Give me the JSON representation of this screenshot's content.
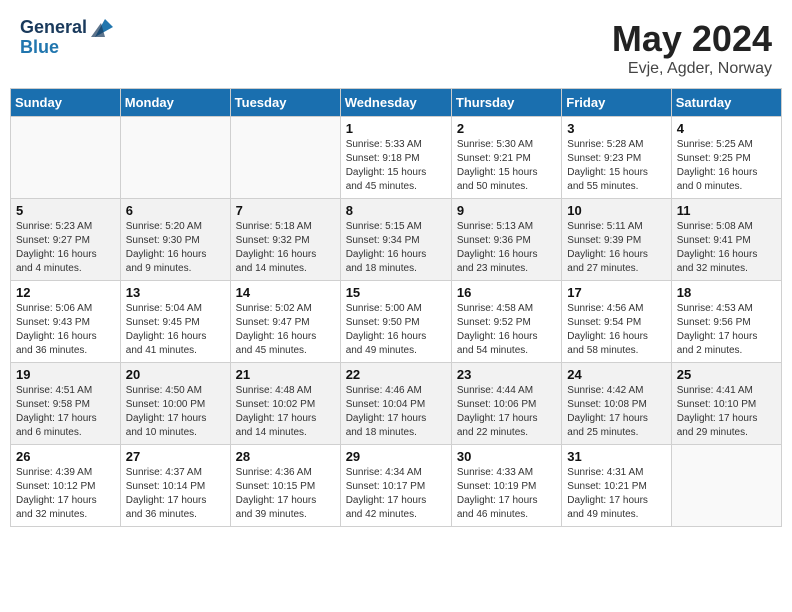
{
  "header": {
    "logo_general": "General",
    "logo_blue": "Blue",
    "month": "May 2024",
    "location": "Evje, Agder, Norway"
  },
  "weekdays": [
    "Sunday",
    "Monday",
    "Tuesday",
    "Wednesday",
    "Thursday",
    "Friday",
    "Saturday"
  ],
  "weeks": [
    [
      {
        "day": "",
        "info": ""
      },
      {
        "day": "",
        "info": ""
      },
      {
        "day": "",
        "info": ""
      },
      {
        "day": "1",
        "info": "Sunrise: 5:33 AM\nSunset: 9:18 PM\nDaylight: 15 hours\nand 45 minutes."
      },
      {
        "day": "2",
        "info": "Sunrise: 5:30 AM\nSunset: 9:21 PM\nDaylight: 15 hours\nand 50 minutes."
      },
      {
        "day": "3",
        "info": "Sunrise: 5:28 AM\nSunset: 9:23 PM\nDaylight: 15 hours\nand 55 minutes."
      },
      {
        "day": "4",
        "info": "Sunrise: 5:25 AM\nSunset: 9:25 PM\nDaylight: 16 hours\nand 0 minutes."
      }
    ],
    [
      {
        "day": "5",
        "info": "Sunrise: 5:23 AM\nSunset: 9:27 PM\nDaylight: 16 hours\nand 4 minutes."
      },
      {
        "day": "6",
        "info": "Sunrise: 5:20 AM\nSunset: 9:30 PM\nDaylight: 16 hours\nand 9 minutes."
      },
      {
        "day": "7",
        "info": "Sunrise: 5:18 AM\nSunset: 9:32 PM\nDaylight: 16 hours\nand 14 minutes."
      },
      {
        "day": "8",
        "info": "Sunrise: 5:15 AM\nSunset: 9:34 PM\nDaylight: 16 hours\nand 18 minutes."
      },
      {
        "day": "9",
        "info": "Sunrise: 5:13 AM\nSunset: 9:36 PM\nDaylight: 16 hours\nand 23 minutes."
      },
      {
        "day": "10",
        "info": "Sunrise: 5:11 AM\nSunset: 9:39 PM\nDaylight: 16 hours\nand 27 minutes."
      },
      {
        "day": "11",
        "info": "Sunrise: 5:08 AM\nSunset: 9:41 PM\nDaylight: 16 hours\nand 32 minutes."
      }
    ],
    [
      {
        "day": "12",
        "info": "Sunrise: 5:06 AM\nSunset: 9:43 PM\nDaylight: 16 hours\nand 36 minutes."
      },
      {
        "day": "13",
        "info": "Sunrise: 5:04 AM\nSunset: 9:45 PM\nDaylight: 16 hours\nand 41 minutes."
      },
      {
        "day": "14",
        "info": "Sunrise: 5:02 AM\nSunset: 9:47 PM\nDaylight: 16 hours\nand 45 minutes."
      },
      {
        "day": "15",
        "info": "Sunrise: 5:00 AM\nSunset: 9:50 PM\nDaylight: 16 hours\nand 49 minutes."
      },
      {
        "day": "16",
        "info": "Sunrise: 4:58 AM\nSunset: 9:52 PM\nDaylight: 16 hours\nand 54 minutes."
      },
      {
        "day": "17",
        "info": "Sunrise: 4:56 AM\nSunset: 9:54 PM\nDaylight: 16 hours\nand 58 minutes."
      },
      {
        "day": "18",
        "info": "Sunrise: 4:53 AM\nSunset: 9:56 PM\nDaylight: 17 hours\nand 2 minutes."
      }
    ],
    [
      {
        "day": "19",
        "info": "Sunrise: 4:51 AM\nSunset: 9:58 PM\nDaylight: 17 hours\nand 6 minutes."
      },
      {
        "day": "20",
        "info": "Sunrise: 4:50 AM\nSunset: 10:00 PM\nDaylight: 17 hours\nand 10 minutes."
      },
      {
        "day": "21",
        "info": "Sunrise: 4:48 AM\nSunset: 10:02 PM\nDaylight: 17 hours\nand 14 minutes."
      },
      {
        "day": "22",
        "info": "Sunrise: 4:46 AM\nSunset: 10:04 PM\nDaylight: 17 hours\nand 18 minutes."
      },
      {
        "day": "23",
        "info": "Sunrise: 4:44 AM\nSunset: 10:06 PM\nDaylight: 17 hours\nand 22 minutes."
      },
      {
        "day": "24",
        "info": "Sunrise: 4:42 AM\nSunset: 10:08 PM\nDaylight: 17 hours\nand 25 minutes."
      },
      {
        "day": "25",
        "info": "Sunrise: 4:41 AM\nSunset: 10:10 PM\nDaylight: 17 hours\nand 29 minutes."
      }
    ],
    [
      {
        "day": "26",
        "info": "Sunrise: 4:39 AM\nSunset: 10:12 PM\nDaylight: 17 hours\nand 32 minutes."
      },
      {
        "day": "27",
        "info": "Sunrise: 4:37 AM\nSunset: 10:14 PM\nDaylight: 17 hours\nand 36 minutes."
      },
      {
        "day": "28",
        "info": "Sunrise: 4:36 AM\nSunset: 10:15 PM\nDaylight: 17 hours\nand 39 minutes."
      },
      {
        "day": "29",
        "info": "Sunrise: 4:34 AM\nSunset: 10:17 PM\nDaylight: 17 hours\nand 42 minutes."
      },
      {
        "day": "30",
        "info": "Sunrise: 4:33 AM\nSunset: 10:19 PM\nDaylight: 17 hours\nand 46 minutes."
      },
      {
        "day": "31",
        "info": "Sunrise: 4:31 AM\nSunset: 10:21 PM\nDaylight: 17 hours\nand 49 minutes."
      },
      {
        "day": "",
        "info": ""
      }
    ]
  ]
}
